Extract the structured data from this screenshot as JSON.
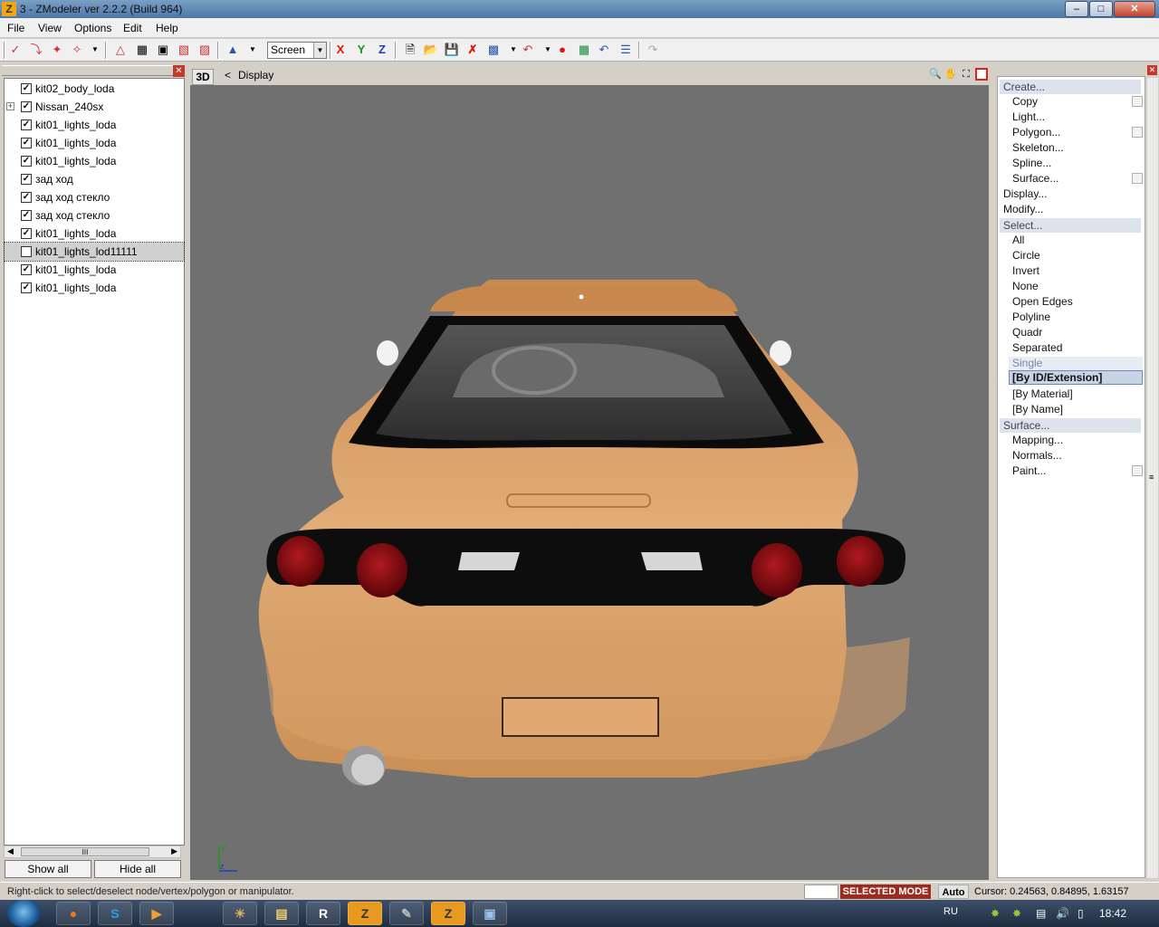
{
  "window": {
    "title": "3 - ZModeler ver 2.2.2 (Build 964)",
    "app_icon": "Z",
    "buttons": [
      "minimize-icon",
      "maximize-icon",
      "close-icon"
    ]
  },
  "menu": [
    {
      "label": "File"
    },
    {
      "label": "View"
    },
    {
      "label": "Options"
    },
    {
      "label": "Edit"
    },
    {
      "label": "Help"
    }
  ],
  "toolbar": {
    "coord_space": "Screen",
    "axis_x": "X",
    "axis_y": "Y",
    "axis_z": "Z"
  },
  "tree": {
    "nodes": [
      {
        "label": "kit02_body_loda",
        "checked": true,
        "expandable": false,
        "selected": false
      },
      {
        "label": "Nissan_240sx",
        "checked": true,
        "expandable": true,
        "selected": false
      },
      {
        "label": "kit01_lights_loda",
        "checked": true,
        "expandable": false,
        "selected": false
      },
      {
        "label": "kit01_lights_loda",
        "checked": true,
        "expandable": false,
        "selected": false
      },
      {
        "label": "kit01_lights_loda",
        "checked": true,
        "expandable": false,
        "selected": false
      },
      {
        "label": "зад ход",
        "checked": true,
        "expandable": false,
        "selected": false
      },
      {
        "label": "зад ход стекло",
        "checked": true,
        "expandable": false,
        "selected": false
      },
      {
        "label": "зад ход стекло",
        "checked": true,
        "expandable": false,
        "selected": false
      },
      {
        "label": "kit01_lights_loda",
        "checked": true,
        "expandable": false,
        "selected": false
      },
      {
        "label": "kit01_lights_lod11111",
        "checked": false,
        "expandable": false,
        "selected": true
      },
      {
        "label": "kit01_lights_loda",
        "checked": true,
        "expandable": false,
        "selected": false
      },
      {
        "label": "kit01_lights_loda",
        "checked": true,
        "expandable": false,
        "selected": false
      }
    ],
    "show_all": "Show all",
    "hide_all": "Hide all",
    "scroll_grip": "III"
  },
  "viewport": {
    "mode_badge": "3D",
    "back": "<",
    "label": "Display",
    "axis_y": "y",
    "axis_z": "z"
  },
  "commands": {
    "create_group": "Create...",
    "create_items": [
      "Copy",
      "Light...",
      "Polygon...",
      "Skeleton...",
      "Spline...",
      "Surface..."
    ],
    "display": "Display...",
    "modify": "Modify...",
    "select_group": "Select...",
    "select_items": [
      "All",
      "Circle",
      "Invert",
      "None",
      "Open Edges",
      "Polyline",
      "Quadr",
      "Separated"
    ],
    "single": "Single",
    "by_id": "[By ID/Extension]",
    "by_material": "[By Material]",
    "by_name": "[By Name]",
    "surface_group": "Surface...",
    "surface_items": [
      "Mapping...",
      "Normals...",
      "Paint..."
    ]
  },
  "status": {
    "hint": "Right-click to select/deselect node/vertex/polygon or manipulator.",
    "mode": "SELECTED MODE",
    "auto": "Auto",
    "cursor": "Cursor: 0.24563, 0.84895, 1.63157"
  },
  "taskbar": {
    "apps": [
      "firefox-icon",
      "skype-icon",
      "media-player-icon",
      "gimp-icon",
      "explorer-icon",
      "rockstar-icon",
      "zmodeler-icon",
      "paint-icon",
      "zmodeler-icon",
      "window-icon"
    ],
    "rockstar_label": "R",
    "zmodeler_label": "Z",
    "lang": "RU",
    "clock": "18:42"
  },
  "colors": {
    "body_paint": "#d49a62",
    "tail_light": "#8a0f12",
    "viewport_bg": "#707070",
    "selected_mode": "#9c2b1f"
  }
}
